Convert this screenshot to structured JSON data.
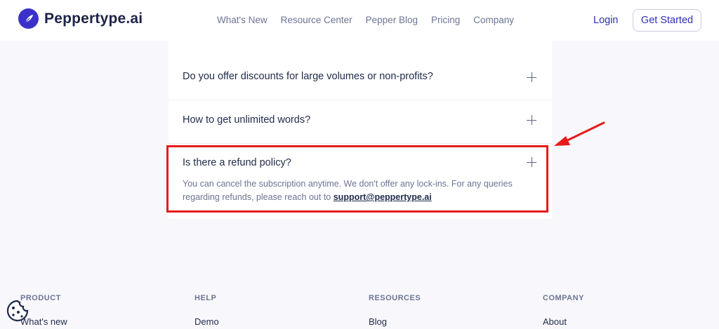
{
  "header": {
    "logo_text": "Peppertype.ai",
    "nav": [
      "What's New",
      "Resource Center",
      "Pepper Blog",
      "Pricing",
      "Company"
    ],
    "login_label": "Login",
    "cta_label": "Get Started"
  },
  "faq": {
    "items": [
      {
        "question": "Do you offer discounts for large volumes or non-profits?"
      },
      {
        "question": "How to get unlimited words?"
      },
      {
        "question": "Is there a refund policy?",
        "answer_text": "You can cancel the subscription anytime. We don't offer any lock-ins. For any queries regarding refunds, please reach out to ",
        "answer_link": "support@peppertype.ai"
      }
    ]
  },
  "footer": {
    "columns": [
      {
        "heading": "PRODUCT",
        "link": "What's new"
      },
      {
        "heading": "HELP",
        "link": "Demo"
      },
      {
        "heading": "RESOURCES",
        "link": "Blog"
      },
      {
        "heading": "COMPANY",
        "link": "About"
      }
    ]
  },
  "colors": {
    "brand": "#3a32c8",
    "accent": "#2f2fb7",
    "highlight": "#e51b1b"
  },
  "icons": [
    "feather-logo-icon",
    "plus-icon",
    "cookie-icon",
    "annotation-arrow"
  ]
}
